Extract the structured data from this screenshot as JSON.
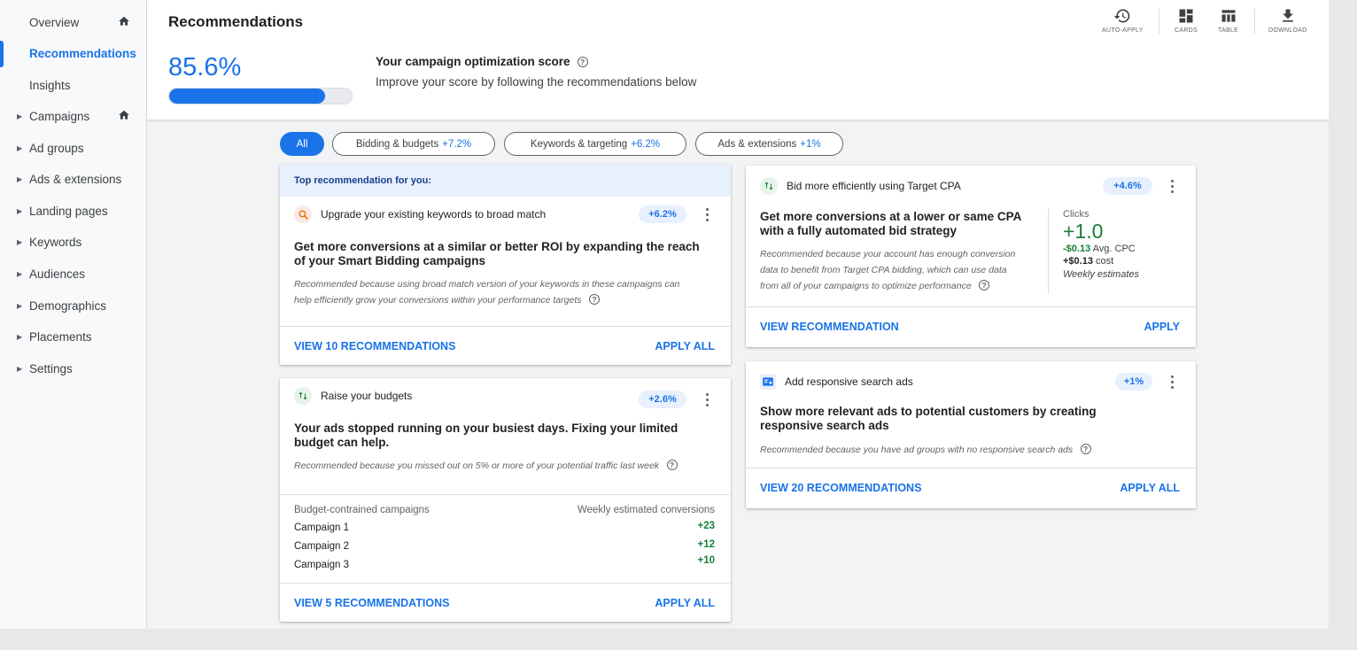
{
  "sidebar": {
    "items": [
      {
        "label": "Overview",
        "caret": false,
        "home": true,
        "active": false
      },
      {
        "label": "Recommendations",
        "caret": false,
        "home": false,
        "active": true
      },
      {
        "label": "Insights",
        "caret": false,
        "home": false,
        "active": false
      },
      {
        "label": "Campaigns",
        "caret": true,
        "home": true,
        "active": false
      },
      {
        "label": "Ad groups",
        "caret": true,
        "home": false,
        "active": false
      },
      {
        "label": "Ads & extensions",
        "caret": true,
        "home": false,
        "active": false
      },
      {
        "label": "Landing pages",
        "caret": true,
        "home": false,
        "active": false
      },
      {
        "label": "Keywords",
        "caret": true,
        "home": false,
        "active": false
      },
      {
        "label": "Audiences",
        "caret": true,
        "home": false,
        "active": false
      },
      {
        "label": "Demographics",
        "caret": true,
        "home": false,
        "active": false
      },
      {
        "label": "Placements",
        "caret": true,
        "home": false,
        "active": false
      },
      {
        "label": "Settings",
        "caret": true,
        "home": false,
        "active": false
      }
    ]
  },
  "header": {
    "title": "Recommendations",
    "tools": {
      "auto_apply": "AUTO-APPLY",
      "cards": "CARDS",
      "table": "TABLE",
      "download": "DOWNLOAD"
    },
    "score": {
      "value": "85.6%",
      "fill_fraction": 0.856,
      "title": "Your campaign optimization score",
      "subtitle": "Improve your score by following the recommendations below"
    }
  },
  "filters": {
    "all": "All",
    "bidding": {
      "label": "Bidding & budgets",
      "pct": "+7.2%"
    },
    "keywords": {
      "label": "Keywords & targeting",
      "pct": "+6.2%"
    },
    "ads": {
      "label": "Ads & extensions",
      "pct": "+1%"
    }
  },
  "cards": {
    "broad_match": {
      "banner": "Top recommendation for you:",
      "heading": "Upgrade your existing keywords to broad match",
      "uplift": "+6.2%",
      "title": "Get more conversions at a similar or better ROI by expanding the reach of your Smart Bidding campaigns",
      "reason": "Recommended because using broad match version of your keywords in these campaigns can help efficiently grow your conversions within your performance targets",
      "view": "VIEW 10 RECOMMENDATIONS",
      "apply": "APPLY ALL"
    },
    "budgets": {
      "heading": "Raise your budgets",
      "uplift": "+2.6%",
      "title": "Your ads stopped running on your busiest days. Fixing your limited budget can help.",
      "reason": "Recommended because you missed out on 5% or more of your potential traffic last week",
      "table_headers": [
        "Budget-contrained campaigns",
        "Weekly estimated conversions"
      ],
      "rows": [
        {
          "name": "Campaign 1",
          "value": "+23"
        },
        {
          "name": "Campaign 2",
          "value": "+12"
        },
        {
          "name": "Campaign 3",
          "value": "+10"
        }
      ],
      "view": "VIEW 5 RECOMMENDATIONS",
      "apply": "APPLY ALL"
    },
    "target_cpa": {
      "heading": "Bid more efficiently using Target CPA",
      "uplift": "+4.6%",
      "title": "Get more conversions at a lower or same CPA with a fully automated bid strategy",
      "reason": "Recommended because your account has enough conversion data to benefit from Target CPA bidding, which can use data from all of your campaigns to optimize performance",
      "metrics": {
        "label": "Clicks",
        "value": "+1.0",
        "cpc_value": "-$0.13",
        "cpc_label": "Avg. CPC",
        "cost_value": "+$0.13",
        "cost_label": "cost",
        "note": "Weekly estimates"
      },
      "view": "VIEW RECOMMENDATION",
      "apply": "APPLY"
    },
    "rsa": {
      "heading": "Add responsive search ads",
      "uplift": "+1%",
      "title": "Show more relevant ads to potential customers by creating responsive search ads",
      "reason": "Recommended because you have ad groups with no responsive search ads",
      "view": "VIEW 20 RECOMMENDATIONS",
      "apply": "APPLY ALL"
    }
  },
  "colors": {
    "accent": "#1a73e8",
    "positive": "#188038",
    "banner": "#e8f0fe"
  }
}
